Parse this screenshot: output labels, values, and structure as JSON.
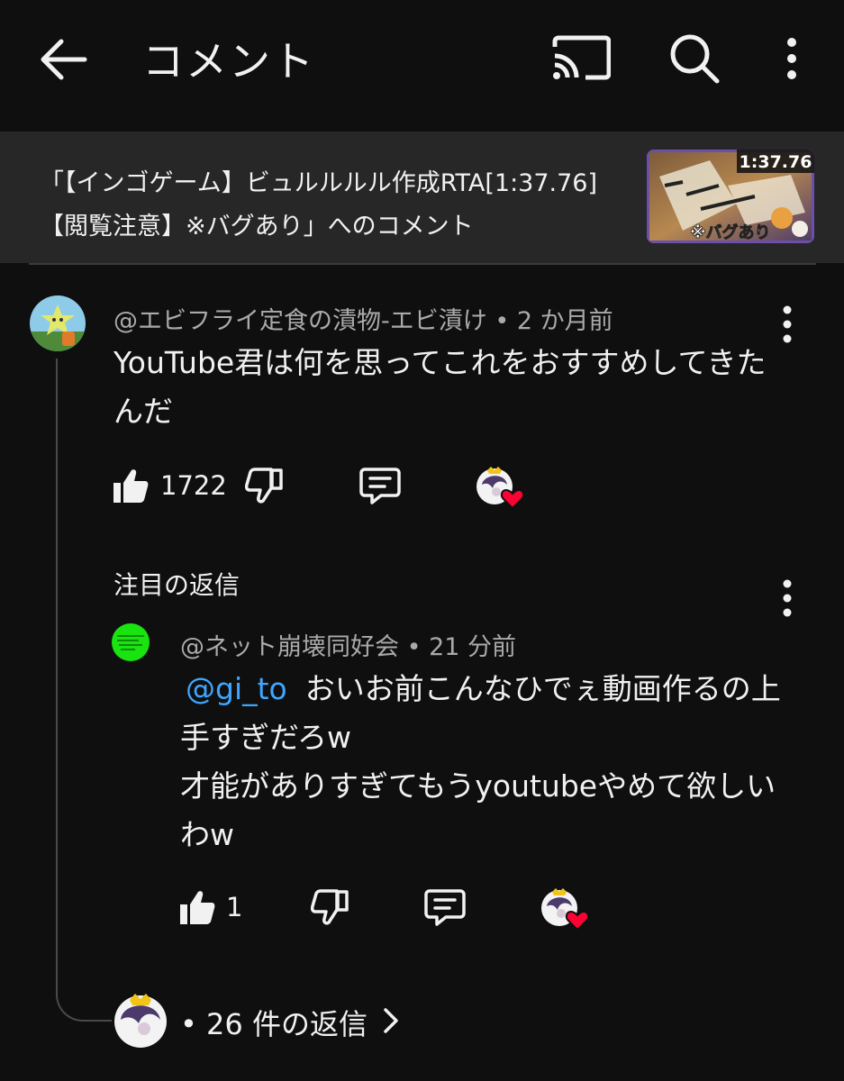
{
  "header": {
    "title": "コメント",
    "icons": [
      "back-arrow-icon",
      "cast-icon",
      "search-icon",
      "more-vertical-icon"
    ]
  },
  "video": {
    "title": "「【インゴゲーム】ビュルルルル作成RTA[1:37.76]【閲覧注意】※バグあり」へのコメント",
    "thumbnail_time": "1:37.76",
    "thumbnail_caption": "※バグあり"
  },
  "comment": {
    "author": "@エビフライ定食の漬物-エビ漬け",
    "separator": " • ",
    "time": "2 か月前",
    "text": "YouTube君は何を思ってこれをおすすめしてきたんだ",
    "likes": "1722"
  },
  "pinned_reply": {
    "label": "注目の返信",
    "author": "@ネット崩壊同好会",
    "separator": " • ",
    "time": "21 分前",
    "mention": "@gi_to",
    "text": "おいお前こんなひでぇ動画作るの上手すぎだろw\n才能がありすぎてもうyoutubeやめて欲しいわw",
    "likes": "1"
  },
  "replies": {
    "bullet": "•",
    "label": "26 件の返信"
  },
  "colors": {
    "background": "#0f0f0f",
    "panel": "#272727",
    "meta": "#aaaaaa",
    "mention": "#3ea6ff",
    "heart": "#ff0033"
  }
}
